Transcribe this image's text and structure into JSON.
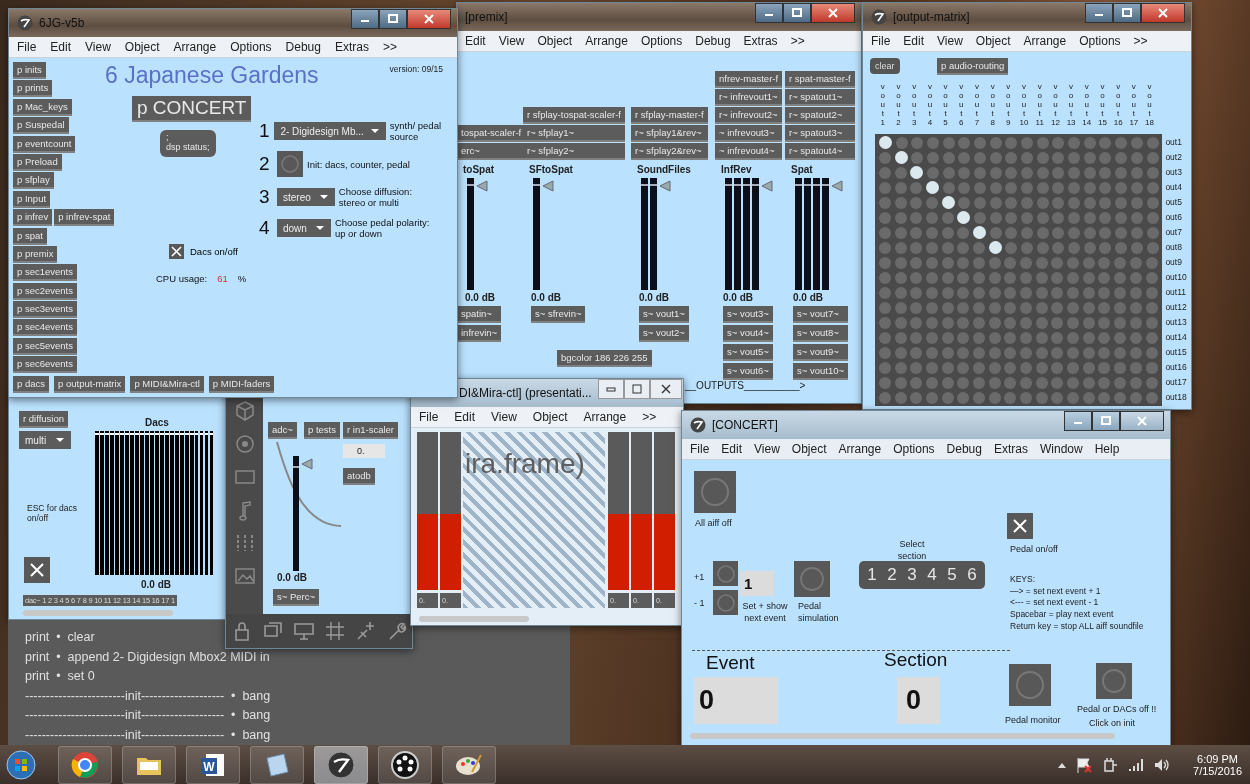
{
  "main": {
    "title": "6JG-v5b",
    "menu": [
      "File",
      "Edit",
      "View",
      "Object",
      "Arrange",
      "Options",
      "Debug",
      "Extras",
      ">>"
    ],
    "objects": [
      [
        "p inits"
      ],
      [
        "p prints"
      ],
      [
        "p Mac_keys"
      ],
      [
        "p Suspedal"
      ],
      [
        "p eventcount"
      ],
      [
        "p Preload"
      ],
      [
        "p sfplay"
      ],
      [
        "p Input"
      ],
      [
        "p infrev",
        "p infrev-spat"
      ],
      [
        "p spat"
      ],
      [
        "p premix"
      ],
      [
        "p sec1events"
      ],
      [
        "p sec2events"
      ],
      [
        "p sec3events"
      ],
      [
        "p sec4events"
      ],
      [
        "p sec5events"
      ],
      [
        "p sec6events"
      ]
    ],
    "bottom_objects": [
      "p dacs",
      "p output-matrix",
      "p MIDI&Mira-ctl",
      "p MIDI-faders"
    ],
    "heading": "6 Japanese Gardens",
    "version": "version: 09/15",
    "concert": "p CONCERT",
    "message": ";\ndsp status;",
    "steps": [
      {
        "number": "1",
        "kind": "menu",
        "value": "2- Digidesign Mb...",
        "label": "synth/ pedal source"
      },
      {
        "number": "2",
        "kind": "bang",
        "label": "Init: dacs, counter, pedal"
      },
      {
        "number": "3",
        "kind": "menu",
        "value": "stereo",
        "label": "Choose diffusion: stereo or multi"
      },
      {
        "number": "4",
        "kind": "menu",
        "value": "down",
        "label": "Choose pedal polarity: up or down"
      }
    ],
    "dacs_toggle": {
      "checked": true,
      "label": "Dacs on/off"
    },
    "cpu": {
      "label": "CPU usage:",
      "value": "61",
      "unit": "%"
    }
  },
  "premix": {
    "title": "[premix]",
    "menu": [
      "Edit",
      "View",
      "Object",
      "Arrange",
      "Options",
      "Debug",
      "Extras",
      ">>"
    ],
    "strips": [
      {
        "top": [
          "tospat-scaler-f",
          "erc~"
        ],
        "label": "toSpat",
        "channels": [
          {
            "level": 0.93
          }
        ],
        "reading": "0.0 dB",
        "sends": [
          "spatin~",
          "infrevin~"
        ]
      },
      {
        "top": [
          "r sfplay-tospat-scaler-f",
          "r~ sfplay1~",
          "r~ sfplay2~"
        ],
        "label": "SFtoSpat",
        "channels": [
          {
            "level": 0.93
          }
        ],
        "reading": "0.0 dB",
        "sends": [
          "s~ sfrevin~"
        ]
      },
      {
        "top": [
          "r sfplay-master-f",
          "r~ sfplay1&rev~",
          "r~ sfplay2&rev~"
        ],
        "label": "SoundFiles",
        "channels": [
          {
            "level": 0.93
          },
          {
            "level": 0.93
          }
        ],
        "reading": "0.0 dB",
        "sends": [
          "s~ vout1~",
          "s~ vout2~"
        ]
      },
      {
        "top": [
          "nfrev-master-f",
          "r~ infrevout1~",
          "r~ infrevout2~",
          "~ infrevout3~",
          "~ infrevout4~"
        ],
        "label": "InfRev",
        "channels": [
          {
            "level": 0.93
          },
          {
            "level": 0.93
          },
          {
            "level": 0.93
          },
          {
            "level": 0.93
          }
        ],
        "reading": "0.0 dB",
        "sends": [
          "s~ vout3~",
          "s~ vout4~",
          "s~ vout5~",
          "s~ vout6~"
        ]
      },
      {
        "top": [
          "r spat-master-f",
          "r~ spatout1~",
          "r~ spatout2~",
          "r~ spatout3~",
          "r~ spatout4~"
        ],
        "label": "Spat",
        "channels": [
          {
            "level": 0.93
          },
          {
            "level": 0.93
          },
          {
            "level": 0.93
          },
          {
            "level": 0.93
          }
        ],
        "reading": "0.0 dB",
        "sends": [
          "s~ vout7~",
          "s~ vout8~",
          "s~ vout9~",
          "s~ vout10~"
        ]
      }
    ],
    "bgcolor": "bgcolor 186 226 255",
    "outputs": "__OUTPUTS__________>"
  },
  "matrix": {
    "title": "[output-matrix]",
    "menu": [
      "File",
      "Edit",
      "View",
      "Object",
      "Arrange",
      "Options",
      ">>"
    ],
    "clear": "clear",
    "routing": "p audio-routing",
    "columns": [
      "v o u t 1",
      "v o u t 2",
      "v o u t 3",
      "v o u t 4",
      "v o u t 5",
      "v o u t 6",
      "v o u t 7",
      "v o u t 8",
      "v o u t 9",
      "v o u t 10",
      "v o u t 11",
      "v o u t 12",
      "v o u t 13",
      "v o u t 14",
      "v o u t 15",
      "v o u t 16",
      "v o u t 17",
      "v o u t 18"
    ],
    "rows": [
      {
        "label": "out1",
        "cells": [
          true,
          false,
          false,
          false,
          false,
          false,
          false,
          false,
          false,
          false,
          false,
          false,
          false,
          false,
          false,
          false,
          false,
          false
        ]
      },
      {
        "label": "out2",
        "cells": [
          false,
          true,
          false,
          false,
          false,
          false,
          false,
          false,
          false,
          false,
          false,
          false,
          false,
          false,
          false,
          false,
          false,
          false
        ]
      },
      {
        "label": "out3",
        "cells": [
          false,
          false,
          true,
          false,
          false,
          false,
          false,
          false,
          false,
          false,
          false,
          false,
          false,
          false,
          false,
          false,
          false,
          false
        ]
      },
      {
        "label": "out4",
        "cells": [
          false,
          false,
          false,
          true,
          false,
          false,
          false,
          false,
          false,
          false,
          false,
          false,
          false,
          false,
          false,
          false,
          false,
          false
        ]
      },
      {
        "label": "out5",
        "cells": [
          false,
          false,
          false,
          false,
          true,
          false,
          false,
          false,
          false,
          false,
          false,
          false,
          false,
          false,
          false,
          false,
          false,
          false
        ]
      },
      {
        "label": "out6",
        "cells": [
          false,
          false,
          false,
          false,
          false,
          true,
          false,
          false,
          false,
          false,
          false,
          false,
          false,
          false,
          false,
          false,
          false,
          false
        ]
      },
      {
        "label": "out7",
        "cells": [
          false,
          false,
          false,
          false,
          false,
          false,
          true,
          false,
          false,
          false,
          false,
          false,
          false,
          false,
          false,
          false,
          false,
          false
        ]
      },
      {
        "label": "out8",
        "cells": [
          false,
          false,
          false,
          false,
          false,
          false,
          false,
          true,
          false,
          false,
          false,
          false,
          false,
          false,
          false,
          false,
          false,
          false
        ]
      },
      {
        "label": "out9",
        "cells": [
          false,
          false,
          false,
          false,
          false,
          false,
          false,
          false,
          false,
          false,
          false,
          false,
          false,
          false,
          false,
          false,
          false,
          false
        ]
      },
      {
        "label": "out10",
        "cells": [
          false,
          false,
          false,
          false,
          false,
          false,
          false,
          false,
          false,
          false,
          false,
          false,
          false,
          false,
          false,
          false,
          false,
          false
        ]
      },
      {
        "label": "out11",
        "cells": [
          false,
          false,
          false,
          false,
          false,
          false,
          false,
          false,
          false,
          false,
          false,
          false,
          false,
          false,
          false,
          false,
          false,
          false
        ]
      },
      {
        "label": "out12",
        "cells": [
          false,
          false,
          false,
          false,
          false,
          false,
          false,
          false,
          false,
          false,
          false,
          false,
          false,
          false,
          false,
          false,
          false,
          false
        ]
      },
      {
        "label": "out13",
        "cells": [
          false,
          false,
          false,
          false,
          false,
          false,
          false,
          false,
          false,
          false,
          false,
          false,
          false,
          false,
          false,
          false,
          false,
          false
        ]
      },
      {
        "label": "out14",
        "cells": [
          false,
          false,
          false,
          false,
          false,
          false,
          false,
          false,
          false,
          false,
          false,
          false,
          false,
          false,
          false,
          false,
          false,
          false
        ]
      },
      {
        "label": "out15",
        "cells": [
          false,
          false,
          false,
          false,
          false,
          false,
          false,
          false,
          false,
          false,
          false,
          false,
          false,
          false,
          false,
          false,
          false,
          false
        ]
      },
      {
        "label": "out16",
        "cells": [
          false,
          false,
          false,
          false,
          false,
          false,
          false,
          false,
          false,
          false,
          false,
          false,
          false,
          false,
          false,
          false,
          false,
          false
        ]
      },
      {
        "label": "out17",
        "cells": [
          false,
          false,
          false,
          false,
          false,
          false,
          false,
          false,
          false,
          false,
          false,
          false,
          false,
          false,
          false,
          false,
          false,
          false
        ]
      },
      {
        "label": "out18",
        "cells": [
          false,
          false,
          false,
          false,
          false,
          false,
          false,
          false,
          false,
          false,
          false,
          false,
          false,
          false,
          false,
          false,
          false,
          false
        ]
      }
    ]
  },
  "dacs": {
    "receive": "r diffusion",
    "menu_value": "multi",
    "title": "Dacs",
    "channels": [
      {
        "level": 0.97
      },
      {
        "level": 0.97
      },
      {
        "level": 0.97
      },
      {
        "level": 0.97
      },
      {
        "level": 0.97
      },
      {
        "level": 0.97
      },
      {
        "level": 0.97
      },
      {
        "level": 0.97
      },
      {
        "level": 0.97
      },
      {
        "level": 0.97
      },
      {
        "level": 0.97
      },
      {
        "level": 0.97
      },
      {
        "level": 0.97
      },
      {
        "level": 0.97
      },
      {
        "level": 0.97
      },
      {
        "level": 0.97
      },
      {
        "level": 0.97
      },
      {
        "level": 0.97
      },
      {
        "level": 0.97
      },
      {
        "level": 0.97
      },
      {
        "level": 0.97
      },
      {
        "level": 0.97
      },
      {
        "level": 0.97
      },
      {
        "level": 0.97
      }
    ],
    "reading": "0.0 dB",
    "esc": "ESC for dacs on/off",
    "toggle": {
      "checked": true
    },
    "dac": "dac~ 1 2 3 4 5 6 7 8 9 10 11 12 13 14 15 16 17 1"
  },
  "perc": {
    "objects": [
      "adc~",
      "p tests",
      "r in1-scaler"
    ],
    "number": "0.",
    "converter": "atodb",
    "channel": {
      "level": 0.9
    },
    "reading": "0.0 dB",
    "send": "s~ Perc~"
  },
  "mira": {
    "title": "DI&Mira-ctl] (presentati...",
    "menu": [
      "File",
      "Edit",
      "View",
      "Object",
      "Arrange",
      ">>"
    ],
    "frame_text": "ira.frame)",
    "sliders": [
      {
        "level": 0.48,
        "reading": "0."
      },
      {
        "level": 0.48,
        "reading": "0."
      },
      {
        "level": 0.48,
        "reading": "0."
      },
      {
        "level": 0.48,
        "reading": "0."
      },
      {
        "level": 0.48,
        "reading": "0."
      }
    ]
  },
  "console": {
    "lines": [
      "print  •  clear",
      "print  •  append 2- Digidesign Mbox2 MIDI in",
      "print  •  set 0",
      "------------------------init--------------------  •  bang",
      "------------------------init--------------------  •  bang",
      "------------------------init--------------------  •  bang"
    ]
  },
  "concert": {
    "title": "[CONCERT]",
    "menu": [
      "File",
      "Edit",
      "View",
      "Object",
      "Arrange",
      "Options",
      "Debug",
      "Extras",
      "Window",
      "Help"
    ],
    "all_off": "All aiff off",
    "plus": "+1",
    "minus": "- 1",
    "next_event": "1",
    "set_label": "Set + show next event",
    "pedal_sim": "Pedal simulation",
    "select_label": "Select section",
    "sections": [
      {
        "label": "1",
        "selected": false
      },
      {
        "label": "2",
        "selected": false
      },
      {
        "label": "3",
        "selected": false
      },
      {
        "label": "4",
        "selected": false
      },
      {
        "label": "5",
        "selected": false
      },
      {
        "label": "6",
        "selected": false
      }
    ],
    "pedal_toggle": {
      "checked": true,
      "label": "Pedal on/off"
    },
    "keys": [
      "KEYS:",
      "—> = set next event + 1",
      "<--- = set next event - 1",
      "Spacebar = play next event",
      "Return key = stop ALL aiff soundfile"
    ],
    "event_label": "Event",
    "event": "0",
    "section_label": "Section",
    "section": "0",
    "pedal_monitor": "Pedal monitor",
    "warning": "Pedal or DACs off !!",
    "click": "Click on init"
  },
  "taskbar": {
    "apps": [
      {
        "kind": "browser",
        "selected": false
      },
      {
        "kind": "folder",
        "selected": false
      },
      {
        "kind": "word",
        "label": "W",
        "selected": false
      },
      {
        "kind": "notepad",
        "selected": false
      },
      {
        "kind": "max",
        "selected": true
      },
      {
        "kind": "dots",
        "selected": false
      },
      {
        "kind": "paint",
        "selected": false
      }
    ],
    "clock": {
      "time": "6:09 PM",
      "date": "7/15/2016"
    }
  }
}
